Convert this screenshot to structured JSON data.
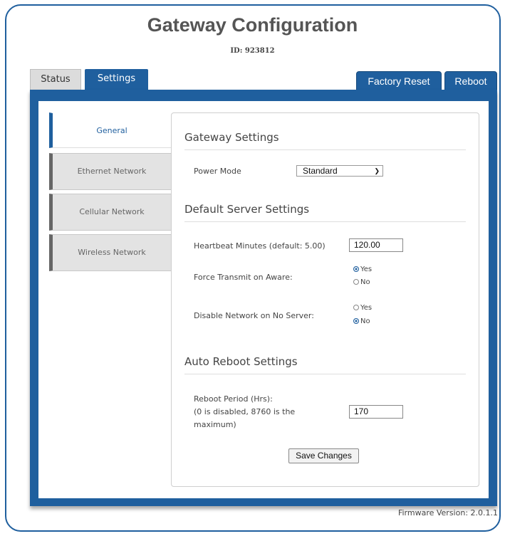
{
  "header": {
    "title": "Gateway Configuration",
    "id_text": "ID: 923812"
  },
  "tabs": [
    {
      "label": "Status",
      "active": false
    },
    {
      "label": "Settings",
      "active": true
    }
  ],
  "actions": {
    "factory_reset": "Factory Reset",
    "reboot": "Reboot"
  },
  "sidebar": {
    "items": [
      {
        "label": "General",
        "active": true
      },
      {
        "label": "Ethernet Network",
        "active": false
      },
      {
        "label": "Cellular Network",
        "active": false
      },
      {
        "label": "Wireless Network",
        "active": false
      }
    ]
  },
  "gateway_settings": {
    "heading": "Gateway Settings",
    "power_mode_label": "Power Mode",
    "power_mode_value": "Standard"
  },
  "server_settings": {
    "heading": "Default Server Settings",
    "heartbeat_label": "Heartbeat Minutes (default: 5.00)",
    "heartbeat_value": "120.00",
    "force_transmit_label": "Force Transmit on Aware:",
    "force_transmit_yes": "Yes",
    "force_transmit_no": "No",
    "force_transmit_selected": "Yes",
    "disable_network_label": "Disable Network on No Server:",
    "disable_network_yes": "Yes",
    "disable_network_no": "No",
    "disable_network_selected": "No"
  },
  "auto_reboot": {
    "heading": "Auto Reboot Settings",
    "period_label_line1": "Reboot Period (Hrs):",
    "period_label_line2": "(0 is disabled, 8760 is the",
    "period_label_line3": "maximum)",
    "period_value": "170"
  },
  "save_label": "Save Changes",
  "footer": {
    "firmware": "Firmware Version: 2.0.1.1"
  },
  "colors": {
    "accent": "#1f5f9e",
    "border": "#1f5f9e"
  }
}
